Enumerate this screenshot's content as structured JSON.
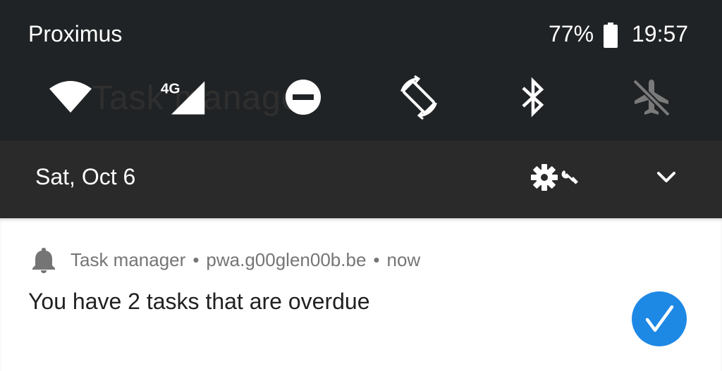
{
  "status_bar": {
    "carrier": "Proximus",
    "battery_percent": "77%",
    "time": "19:57",
    "battery_icon": "battery-icon"
  },
  "background_app": {
    "title": "Task manager"
  },
  "quick_settings": {
    "tiles": [
      {
        "name": "wifi",
        "icon": "wifi-icon",
        "active": true
      },
      {
        "name": "mobile-data",
        "icon": "signal-4g-icon",
        "label": "4G",
        "active": true
      },
      {
        "name": "do-not-disturb",
        "icon": "do-not-disturb-icon",
        "active": true
      },
      {
        "name": "auto-rotate",
        "icon": "auto-rotate-icon",
        "active": true
      },
      {
        "name": "bluetooth",
        "icon": "bluetooth-icon",
        "active": true
      },
      {
        "name": "airplane-mode",
        "icon": "airplane-off-icon",
        "active": false
      }
    ]
  },
  "date_bar": {
    "date": "Sat, Oct 6",
    "settings_icon": "gear-icon",
    "wrench_icon": "wrench-icon",
    "expand_icon": "chevron-down-icon"
  },
  "notification": {
    "app_name": "Task manager",
    "separator": "•",
    "source": "pwa.g00glen00b.be",
    "time": "now",
    "message": "You have 2 tasks that are overdue",
    "icon": "bell-icon",
    "badge_icon": "check-icon",
    "badge_color": "#1e88e5"
  },
  "colors": {
    "panel_background": "#202325",
    "date_bar_background": "#2a2a2a",
    "active_icon": "#ffffff",
    "inactive_icon": "#7a7a7a"
  }
}
